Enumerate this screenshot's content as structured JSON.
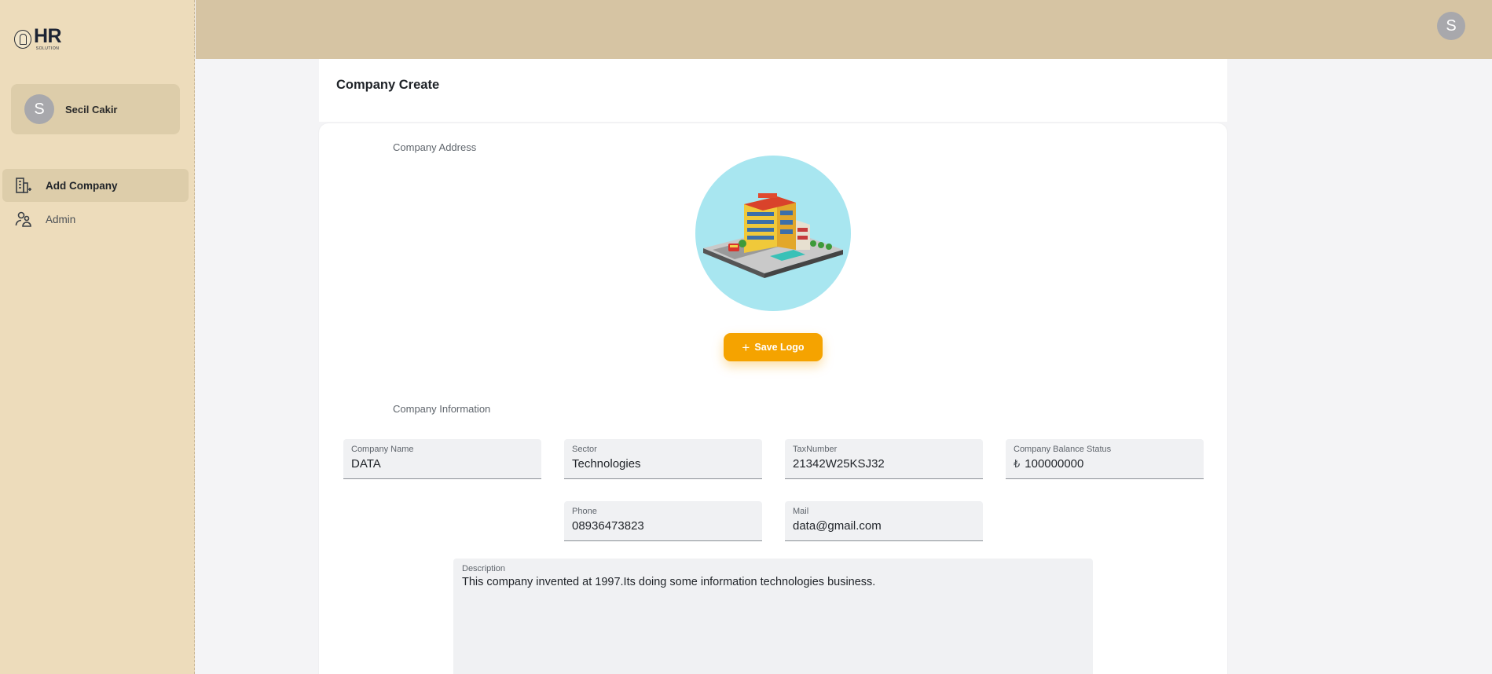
{
  "brand": {
    "logo_text": "HR",
    "logo_subtext": "SOLUTION"
  },
  "user": {
    "avatar_initial": "S",
    "name": "Secil Cakir"
  },
  "sidebar": {
    "items": [
      {
        "label": "Add Company",
        "icon": "building-add-icon",
        "active": true
      },
      {
        "label": "Admin",
        "icon": "admin-users-icon",
        "active": false
      }
    ]
  },
  "topbar": {
    "avatar_initial": "S"
  },
  "page": {
    "title": "Company Create"
  },
  "address_section": {
    "label": "Company Address",
    "save_logo_label": "Save Logo"
  },
  "info_section": {
    "label": "Company Information",
    "fields": {
      "company_name": {
        "label": "Company Name",
        "value": "DATA"
      },
      "sector": {
        "label": "Sector",
        "value": "Technologies"
      },
      "tax_number": {
        "label": "TaxNumber",
        "value": "21342W25KSJ32"
      },
      "balance": {
        "label": "Company Balance Status",
        "currency": "₺",
        "value": "100000000"
      },
      "phone": {
        "label": "Phone",
        "value": "08936473823"
      },
      "mail": {
        "label": "Mail",
        "value": "data@gmail.com"
      },
      "description": {
        "label": "Description",
        "value": "This company invented at 1997.Its doing some information technologies business."
      }
    }
  },
  "colors": {
    "sidebar_bg": "#eddcbb",
    "topbar_bg": "#d6c4a3",
    "accent": "#f5a300",
    "logo_circle_bg": "#a8e6f0"
  }
}
